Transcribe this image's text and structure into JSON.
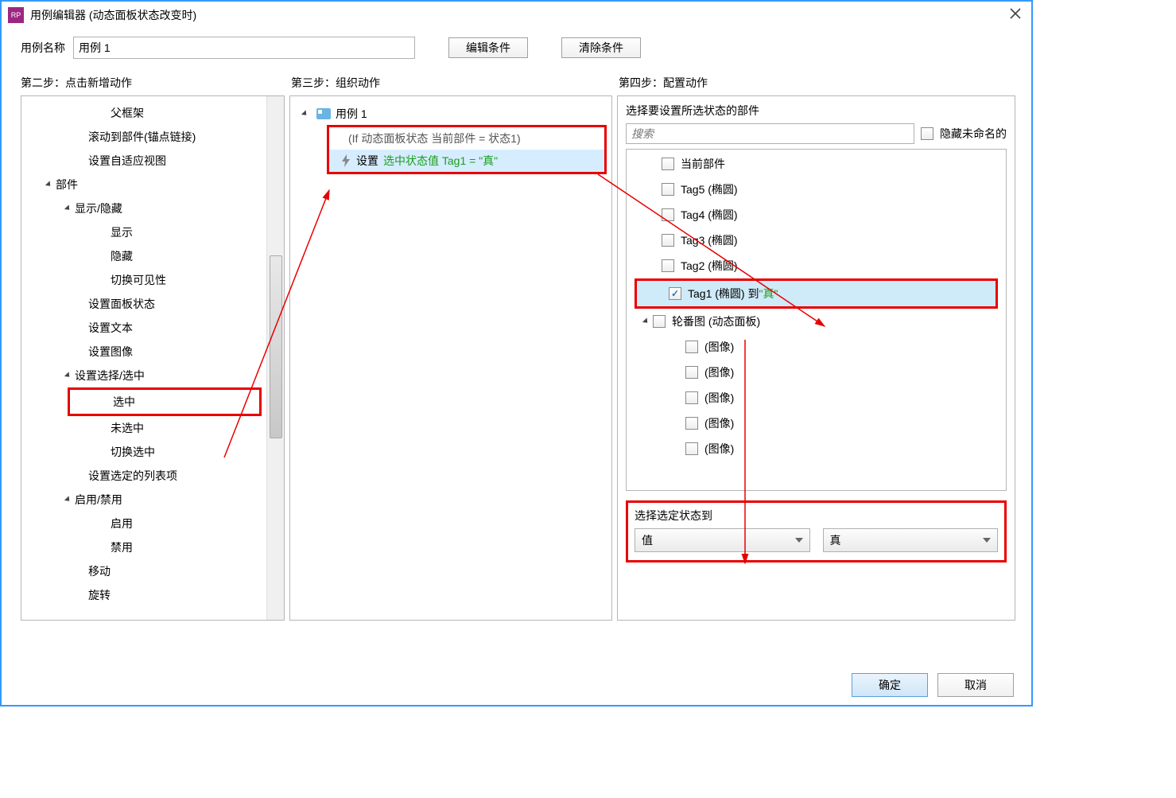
{
  "titlebar": {
    "title": "用例编辑器 (动态面板状态改变时)"
  },
  "case_name": {
    "label": "用例名称",
    "value": "用例 1"
  },
  "buttons": {
    "edit_condition": "编辑条件",
    "clear_condition": "清除条件",
    "ok": "确定",
    "cancel": "取消"
  },
  "steps": {
    "s1": "第二步：点击新增动作",
    "s2": "第三步：组织动作",
    "s3": "第四步：配置动作"
  },
  "action_tree": {
    "items": [
      {
        "label": "父框架",
        "indent": 4
      },
      {
        "label": "滚动到部件(锚点链接)",
        "indent": 3
      },
      {
        "label": "设置自适应视图",
        "indent": 3
      },
      {
        "label": "部件",
        "indent": 1,
        "arrow": true
      },
      {
        "label": "显示/隐藏",
        "indent": 2,
        "arrow": true
      },
      {
        "label": "显示",
        "indent": 4
      },
      {
        "label": "隐藏",
        "indent": 4
      },
      {
        "label": "切换可见性",
        "indent": 4
      },
      {
        "label": "设置面板状态",
        "indent": 3
      },
      {
        "label": "设置文本",
        "indent": 3
      },
      {
        "label": "设置图像",
        "indent": 3
      },
      {
        "label": "设置选择/选中",
        "indent": 2,
        "arrow": true
      },
      {
        "label": "选中",
        "indent": 4,
        "highlight": true
      },
      {
        "label": "未选中",
        "indent": 4
      },
      {
        "label": "切换选中",
        "indent": 4
      },
      {
        "label": "设置选定的列表项",
        "indent": 3
      },
      {
        "label": "启用/禁用",
        "indent": 2,
        "arrow": true
      },
      {
        "label": "启用",
        "indent": 4
      },
      {
        "label": "禁用",
        "indent": 4
      },
      {
        "label": "移动",
        "indent": 3
      },
      {
        "label": "旋转",
        "indent": 3
      }
    ]
  },
  "organize": {
    "case_label": "用例 1",
    "condition": "(If 动态面板状态 当前部件 = 状态1)",
    "action_prefix": "设置 ",
    "action_main": "选中状态值 Tag1 = \"真\""
  },
  "configure": {
    "header": "选择要设置所选状态的部件",
    "search_placeholder": "搜索",
    "hide_unnamed": "隐藏未命名的",
    "widgets": [
      {
        "label": "当前部件",
        "indent": 1
      },
      {
        "label": "Tag5 (椭圆)",
        "indent": 1
      },
      {
        "label": "Tag4 (椭圆)",
        "indent": 1
      },
      {
        "label": "Tag3 (椭圆)",
        "indent": 1
      },
      {
        "label": "Tag2 (椭圆)",
        "indent": 1
      },
      {
        "label_pre": "Tag1 (椭圆) 到",
        "label_suf": "\"真\"",
        "indent": 1,
        "checked": true,
        "selected": true,
        "highlight": true
      },
      {
        "label": "轮番图 (动态面板)",
        "indent": 1,
        "arrow": true
      },
      {
        "label": "(图像)",
        "indent": 2
      },
      {
        "label": "(图像)",
        "indent": 2
      },
      {
        "label": "(图像)",
        "indent": 2
      },
      {
        "label": "(图像)",
        "indent": 2
      },
      {
        "label": "(图像)",
        "indent": 2
      }
    ],
    "state_label": "选择选定状态到",
    "dropdown1": "值",
    "dropdown2": "真"
  }
}
